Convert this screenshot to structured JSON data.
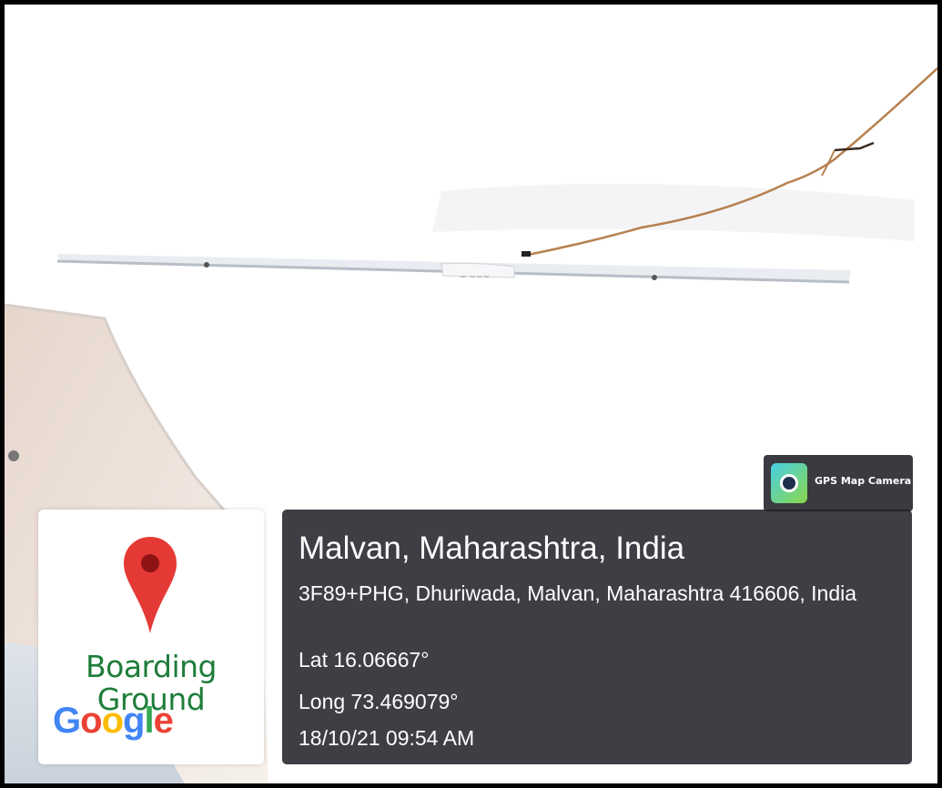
{
  "location": {
    "title": "Malvan, Maharashtra, India",
    "address": "3F89+PHG, Dhuriwada, Malvan, Maharashtra 416606, India",
    "latitude": "Lat 16.06667°",
    "longitude": "Long 73.469079°",
    "datetime": "18/10/21 09:54 AM"
  },
  "map_thumbnail": {
    "place_label": "Boarding Ground",
    "logo_text": "Google",
    "pin_icon": "location-pin-icon"
  },
  "app_badge": {
    "name": "GPS Map Camera",
    "icon": "gps-map-camera-app-icon"
  },
  "photo": {
    "subject": "ceiling-mounted tube light fixture with wire on white ceiling"
  },
  "colors": {
    "pin_red": "#E53935",
    "place_label_green": "#1e7d3a",
    "panel_bg": "#1e2026"
  }
}
